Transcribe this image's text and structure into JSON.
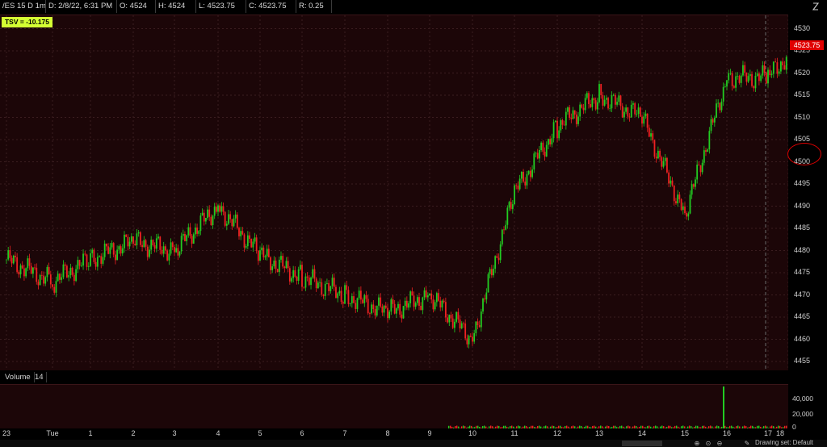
{
  "header": {
    "symbol": "/ES 15 D 1m",
    "date": "D: 2/8/22, 6:31 PM",
    "open": "O: 4524",
    "high": "H: 4524",
    "low": "L: 4523.75",
    "close": "C: 4523.75",
    "range": "R: 0.25"
  },
  "indicator": {
    "label": "TSV = -10.175"
  },
  "price_axis": {
    "ticks": [
      "4530",
      "4525",
      "4520",
      "4515",
      "4510",
      "4505",
      "4500",
      "4495",
      "4490",
      "4485",
      "4480",
      "4475",
      "4470",
      "4465",
      "4460",
      "4455"
    ],
    "last_price": "4523.75"
  },
  "volume": {
    "label": "Volume",
    "count": "14",
    "ticks": [
      "40,000",
      "20,000",
      "0"
    ]
  },
  "time_axis": {
    "labels": [
      "23",
      "Tue",
      "1",
      "2",
      "3",
      "4",
      "5",
      "6",
      "7",
      "8",
      "9",
      "10",
      "11",
      "12",
      "13",
      "14",
      "15",
      "16",
      "17",
      "18"
    ]
  },
  "footer": {
    "drawing_set": "Drawing set: Default"
  },
  "colors": {
    "up": "#22cc22",
    "down": "#ee2222",
    "background": "#1c0608",
    "tsv_badge": "#d4ff33",
    "annotation": "#dd0000"
  },
  "icons": [
    "chevron-icon",
    "zoom-in-icon",
    "zoom-reset-icon",
    "zoom-out-icon",
    "pencil-icon"
  ],
  "chart_data": {
    "type": "candlestick",
    "ylim": [
      4453,
      4533
    ],
    "series": [
      {
        "x": [
          "23",
          "Tue",
          "1",
          "2",
          "3",
          "4",
          "5",
          "6",
          "7",
          "8",
          "9",
          "10",
          "11",
          "12",
          "13",
          "14",
          "15",
          "16",
          "17",
          "18"
        ],
        "close": [
          4478,
          4473,
          4478,
          4482,
          4480,
          4490,
          4479,
          4474,
          4470,
          4466,
          4470,
          4460,
          4493,
          4508,
          4515,
          4510,
          4488,
          4519,
          4519,
          4524
        ]
      }
    ]
  }
}
